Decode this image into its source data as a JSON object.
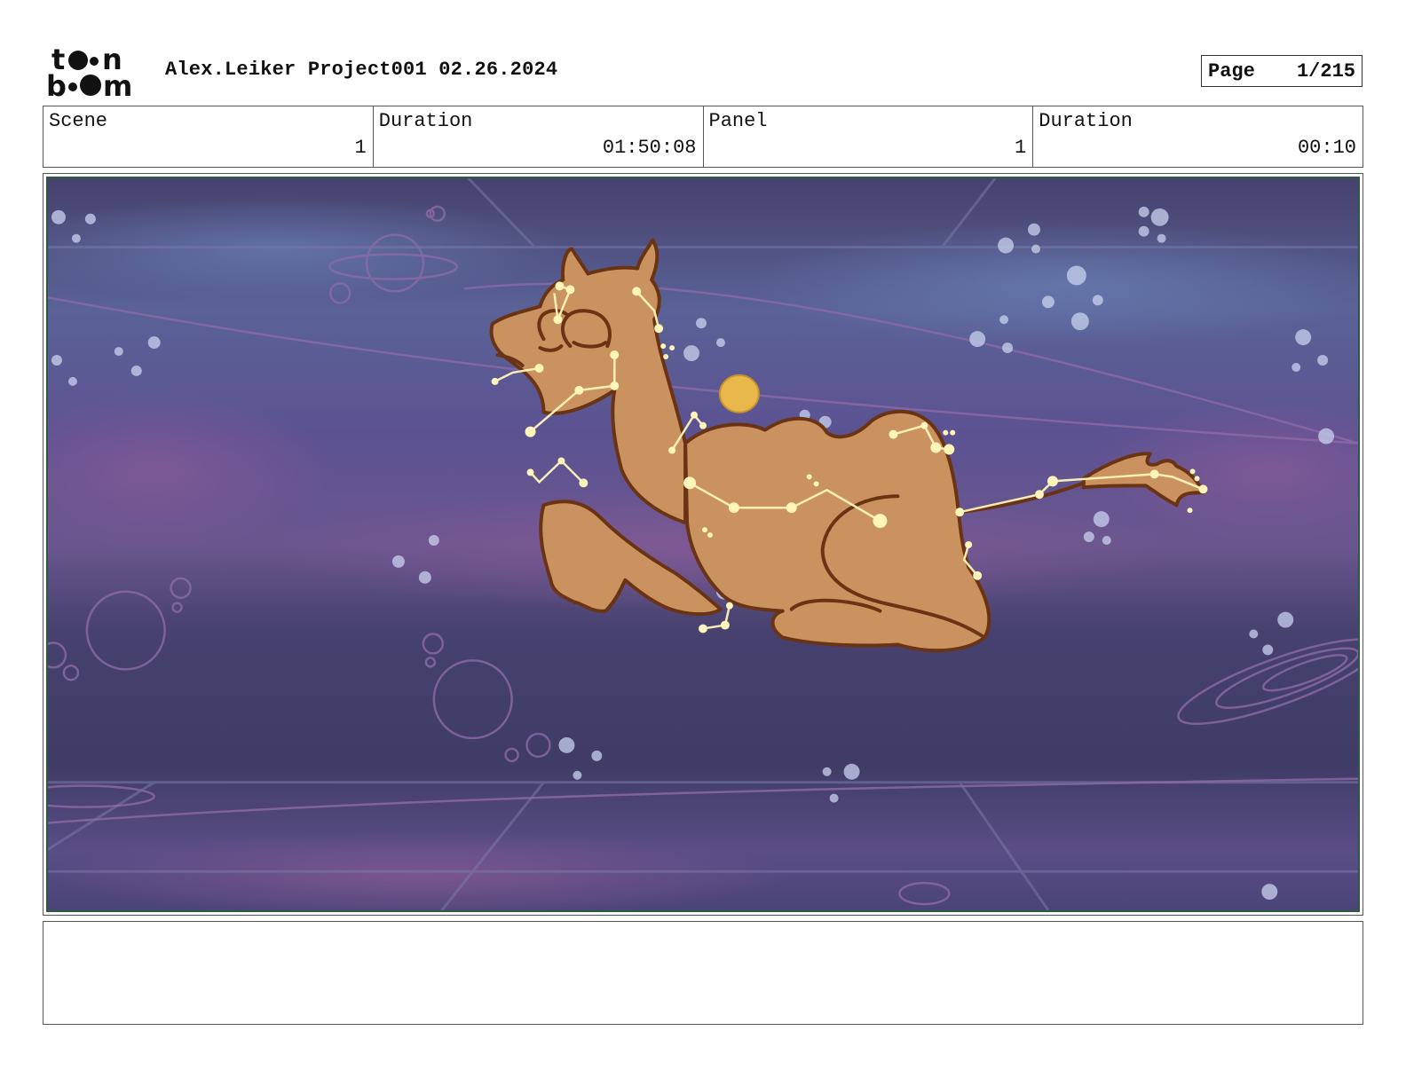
{
  "header": {
    "logo": {
      "line1": "toon",
      "line2": "boom"
    },
    "title": "Alex.Leiker Project001 02.26.2024",
    "page_label": "Page",
    "page_value": "1/215"
  },
  "info": {
    "scene_label": "Scene",
    "scene_value": "1",
    "scene_duration_label": "Duration",
    "scene_duration_value": "01:50:08",
    "panel_label": "Panel",
    "panel_value": "1",
    "panel_duration_label": "Duration",
    "panel_duration_value": "00:10"
  },
  "panel_image": {
    "subject": "camel-constellation-illustration",
    "colors": {
      "sky_dark": "#3f3f6a",
      "sky_mid": "#5a4f8c",
      "nebula_purple": "#7a4e8e",
      "camel_fill": "#c9925f",
      "camel_outline": "#6a3414",
      "star": "#fff5b8",
      "moon": "#e8b84a",
      "sketch_line": "#8c6aa6"
    }
  },
  "notes": {
    "text": ""
  }
}
